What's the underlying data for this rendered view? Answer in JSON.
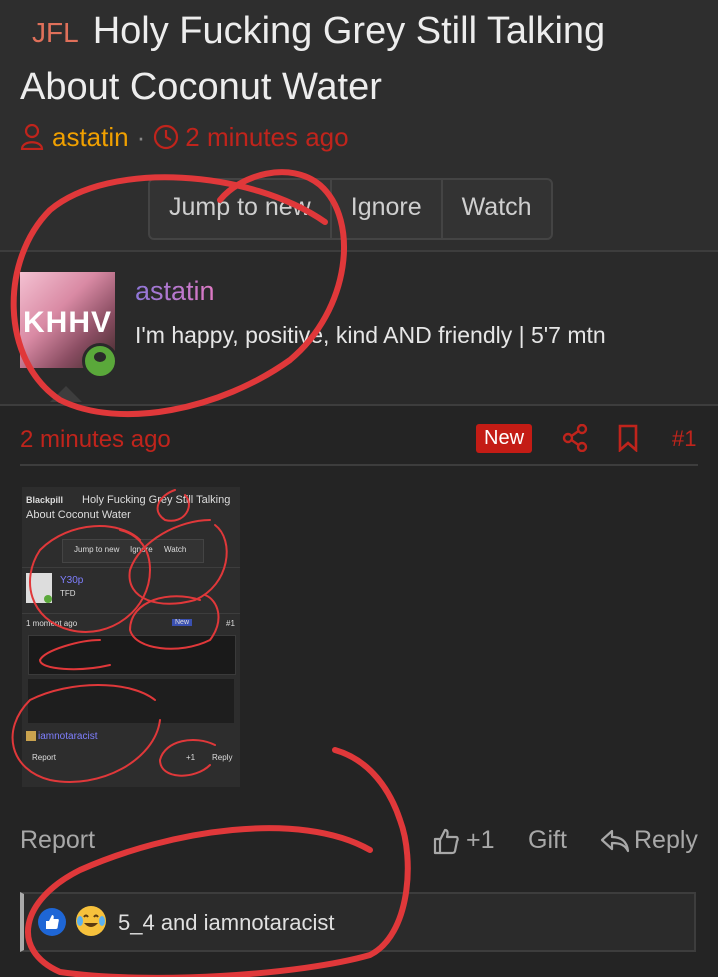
{
  "thread": {
    "prefix": "JFL",
    "title": "Holy Fucking Grey Still Talking About Coconut Water",
    "author": "astatin",
    "time": "2 minutes ago",
    "meta_separator": "·"
  },
  "actions": {
    "jump": "Jump to new",
    "ignore": "Ignore",
    "watch": "Watch"
  },
  "profile": {
    "avatar_text": "KHHV",
    "username": "astatin",
    "user_title": "I'm happy, positive, kind AND friendly | 5'7 mtn",
    "online": true
  },
  "post": {
    "time": "2 minutes ago",
    "badge": "New",
    "number": "#1",
    "attachment": {
      "forum": "Blackpill",
      "title_line1": "Holy Fucking Grey Still Talking",
      "title_line2": "About Coconut Water",
      "btn1": "Jump to new",
      "btn2": "Ignore",
      "btn3": "Watch",
      "user": "Y30p",
      "user_sub": "TFD",
      "time": "1 moment ago",
      "badge": "New",
      "num": "#1",
      "reply_user": "iamnotaracist",
      "report": "Report",
      "likes": "+1",
      "reply": "Reply"
    }
  },
  "footer": {
    "report": "Report",
    "like_count": "+1",
    "gift": "Gift",
    "reply": "Reply"
  },
  "reactions": {
    "text": "5_4 and iamnotaracist",
    "icons": [
      "like-reaction",
      "crying-laughing-reaction"
    ]
  },
  "colors": {
    "accent_red": "#c0241c",
    "author_orange": "#f0a000",
    "annotation_red": "#e0383a"
  }
}
